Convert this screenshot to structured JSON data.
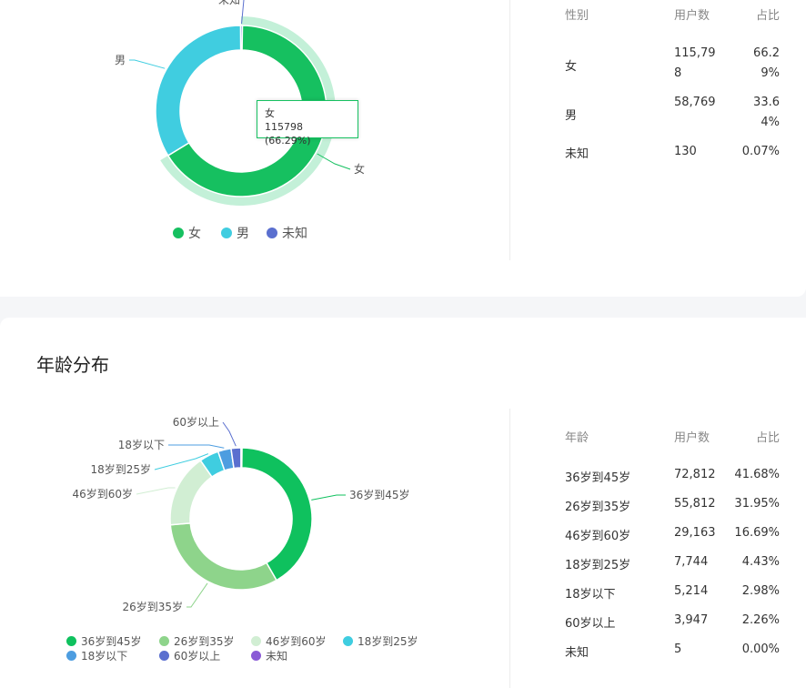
{
  "gender": {
    "table": {
      "headers": [
        "性别",
        "用户数",
        "占比"
      ],
      "rows": [
        [
          "女",
          "115,798",
          "66.29%"
        ],
        [
          "男",
          "58,769",
          "33.64%"
        ],
        [
          "未知",
          "130",
          "0.07%"
        ]
      ]
    },
    "tooltip": {
      "name": "女",
      "value": "115798 (66.29%)"
    }
  },
  "age": {
    "title": "年龄分布",
    "table": {
      "headers": [
        "年龄",
        "用户数",
        "占比"
      ],
      "rows": [
        [
          "36岁到45岁",
          "72,812",
          "41.68%"
        ],
        [
          "26岁到35岁",
          "55,812",
          "31.95%"
        ],
        [
          "46岁到60岁",
          "29,163",
          "16.69%"
        ],
        [
          "18岁到25岁",
          "7,744",
          "4.43%"
        ],
        [
          "18岁以下",
          "5,214",
          "2.98%"
        ],
        [
          "60岁以上",
          "3,947",
          "2.26%"
        ],
        [
          "未知",
          "5",
          "0.00%"
        ]
      ]
    }
  },
  "chart_data": [
    {
      "type": "pie",
      "title": "",
      "categories": [
        "女",
        "男",
        "未知"
      ],
      "values": [
        115798,
        58769,
        130
      ],
      "percents": [
        66.29,
        33.64,
        0.07
      ],
      "colors": [
        "#16c060",
        "#40cde0",
        "#5a6fcf"
      ],
      "hover_color": "#c3f0d8",
      "legend": "bottom-center"
    },
    {
      "type": "pie",
      "title": "",
      "categories": [
        "36岁到45岁",
        "26岁到35岁",
        "46岁到60岁",
        "18岁到25岁",
        "18岁以下",
        "60岁以上",
        "未知"
      ],
      "values": [
        72812,
        55812,
        29163,
        7744,
        5214,
        3947,
        5
      ],
      "percents": [
        41.68,
        31.95,
        16.69,
        4.43,
        2.98,
        2.26,
        0.0
      ],
      "colors": [
        "#0fc15e",
        "#8ed48b",
        "#d1eed3",
        "#3fcde0",
        "#4d9de0",
        "#5a6fcf",
        "#8a5bd6"
      ],
      "legend": "bottom-left"
    }
  ]
}
